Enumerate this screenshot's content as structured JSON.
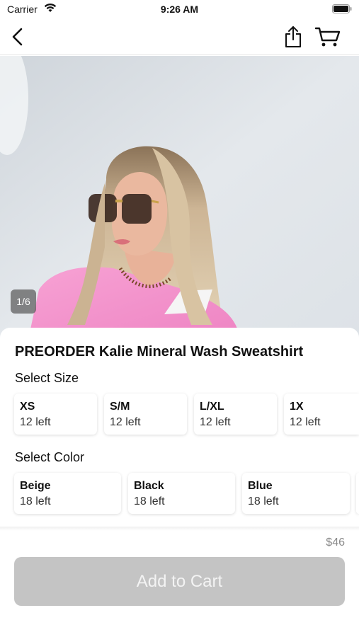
{
  "status_bar": {
    "carrier": "Carrier",
    "time": "9:26 AM"
  },
  "nav": {
    "back_icon": "chevron-left-icon",
    "share_icon": "share-icon",
    "cart_icon": "cart-icon"
  },
  "gallery": {
    "page_indicator": "1/6",
    "total_images": 6,
    "current_image": 1
  },
  "product": {
    "title": "PREORDER Kalie Mineral Wash Sweatshirt",
    "size_label": "Select Size",
    "sizes": [
      {
        "name": "XS",
        "stock": "12 left"
      },
      {
        "name": "S/M",
        "stock": "12 left"
      },
      {
        "name": "L/XL",
        "stock": "12 left"
      },
      {
        "name": "1X",
        "stock": "12 left"
      }
    ],
    "color_label": "Select Color",
    "colors": [
      {
        "name": "Beige",
        "stock": "18 left"
      },
      {
        "name": "Black",
        "stock": "18 left"
      },
      {
        "name": "Blue",
        "stock": "18 left"
      }
    ],
    "price": "$46",
    "add_to_cart_label": "Add to Cart"
  },
  "colors": {
    "button_disabled": "#c4c4c4",
    "sweatshirt_pink": "#f28bc9",
    "background": "#ffffff"
  }
}
